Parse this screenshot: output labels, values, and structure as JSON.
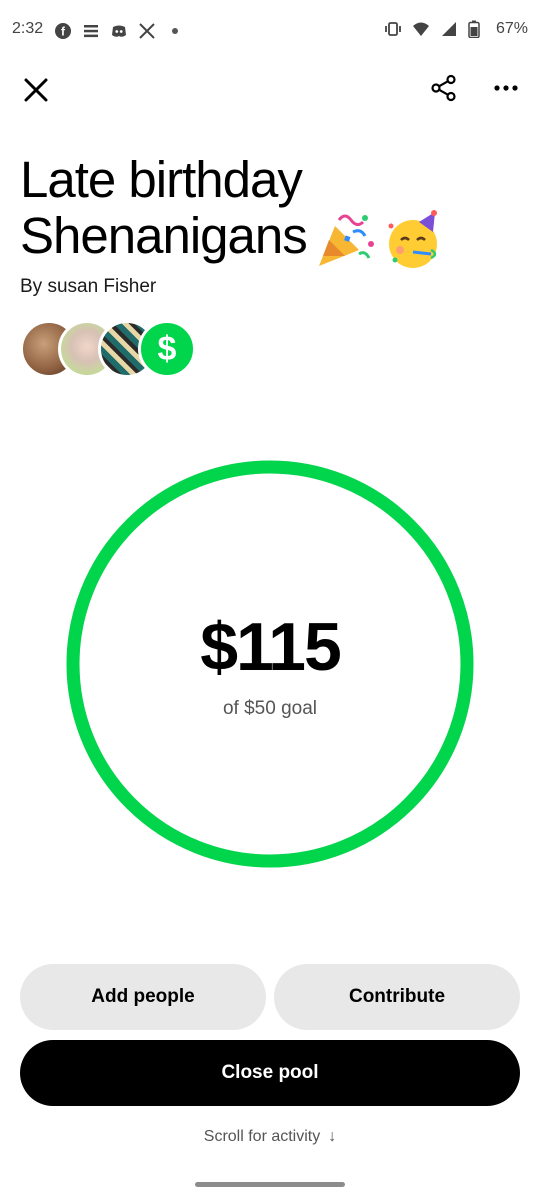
{
  "status_bar": {
    "time": "2:32",
    "battery": "67%",
    "left_icons": [
      "facebook-icon",
      "e-icon",
      "discord-icon",
      "x-icon",
      "dot-icon"
    ],
    "right_icons": [
      "vibrate-icon",
      "wifi-icon",
      "signal-icon",
      "battery-icon"
    ]
  },
  "topbar": {
    "close_icon": "close-icon",
    "share_icon": "share-icon",
    "more_icon": "more-icon"
  },
  "pool": {
    "title_line1": "Late birthday",
    "title_line2": "Shenanigans",
    "title_emojis": [
      "party-popper-icon",
      "partying-face-icon"
    ],
    "byline": "By susan Fisher",
    "amount": "$115",
    "goal_text": "of $50 goal",
    "progress_fraction": 1.0
  },
  "avatars": [
    "avatar-1",
    "avatar-2",
    "avatar-3",
    "cash-app-dollar-icon"
  ],
  "actions": {
    "add_people": "Add people",
    "contribute": "Contribute",
    "close_pool": "Close pool"
  },
  "footer": {
    "scroll_hint": "Scroll for activity",
    "scroll_arrow": "↓"
  },
  "colors": {
    "accent_green": "#00D54B",
    "button_light": "#E8E8E8",
    "button_dark": "#000000"
  }
}
